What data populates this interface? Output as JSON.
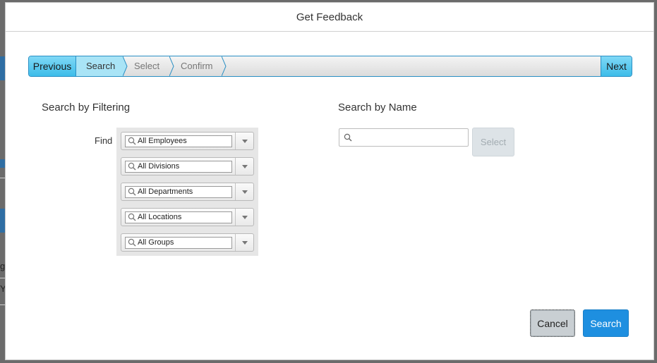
{
  "dialog": {
    "title": "Get Feedback"
  },
  "wizard": {
    "previous_label": "Previous",
    "next_label": "Next",
    "steps": [
      {
        "label": "Search",
        "active": true
      },
      {
        "label": "Select",
        "active": false
      },
      {
        "label": "Confirm",
        "active": false
      }
    ]
  },
  "filter": {
    "title": "Search by Filtering",
    "find_label": "Find",
    "combos": [
      {
        "value": "All Employees"
      },
      {
        "value": "All Divisions"
      },
      {
        "value": "All Departments"
      },
      {
        "value": "All Locations"
      },
      {
        "value": "All Groups"
      }
    ]
  },
  "name_search": {
    "title": "Search by Name",
    "value": "",
    "select_label": "Select"
  },
  "footer": {
    "cancel_label": "Cancel",
    "search_label": "Search"
  },
  "background": {
    "partial_text_1": "gs",
    "partial_text_2": "Y"
  },
  "colors": {
    "accent": "#1e8fe0",
    "wizard_active": "#a9e4f6",
    "wizard_button": "#3dbde9"
  }
}
